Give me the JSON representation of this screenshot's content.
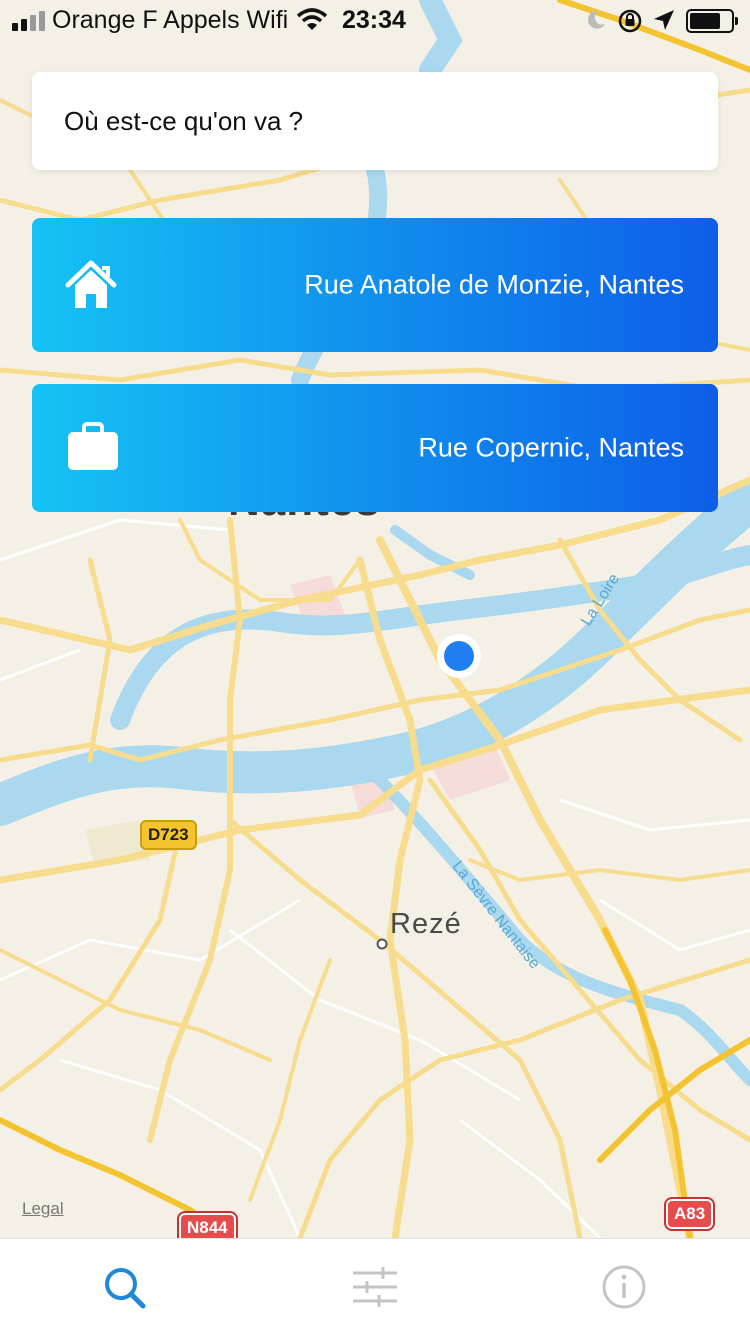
{
  "status_bar": {
    "carrier": "Orange F Appels Wifi",
    "time": "23:34",
    "icons": [
      "signal-icon",
      "wifi-icon",
      "moon-icon",
      "orientation-lock-icon",
      "location-arrow-icon",
      "battery-icon"
    ]
  },
  "search": {
    "placeholder": "Où est-ce qu'on va ?"
  },
  "destinations": [
    {
      "icon": "home-icon",
      "label": "Rue Anatole de Monzie, Nantes"
    },
    {
      "icon": "briefcase-icon",
      "label": "Rue Copernic, Nantes"
    }
  ],
  "map": {
    "city_label": "Nantes",
    "town_label": "Rezé",
    "river_loire": "La Loire",
    "river_sevre": "La Sèvre Nantaise",
    "road_d723": "D723",
    "road_n844": "N844",
    "road_a83": "A83",
    "legal": "Legal",
    "colors": {
      "land": "#f5f0e6",
      "water": "#a9d8ef",
      "road": "#f6dc8c",
      "highway": "#f4c430",
      "user_dot": "#1f7ef2"
    }
  },
  "tabbar": {
    "tabs": [
      {
        "icon": "search-icon",
        "active": true
      },
      {
        "icon": "sliders-icon",
        "active": false
      },
      {
        "icon": "info-icon",
        "active": false
      }
    ],
    "colors": {
      "active": "#1e88d8",
      "inactive": "#c4c4c4"
    }
  }
}
